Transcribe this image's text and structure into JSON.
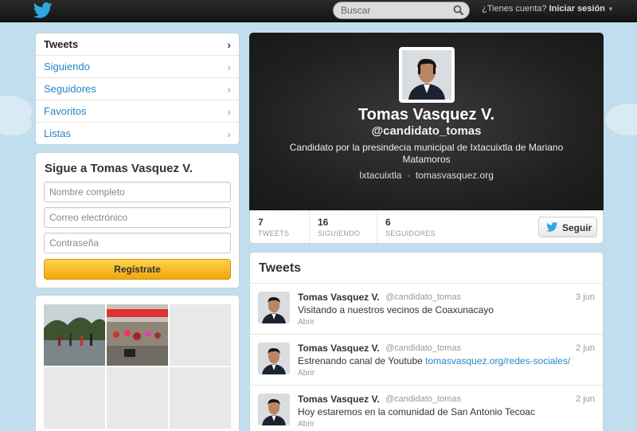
{
  "topbar": {
    "search_placeholder": "Buscar",
    "account_question": "¿Tienes cuenta?",
    "login_label": "Iniciar sesión"
  },
  "nav": {
    "items": [
      {
        "label": "Tweets",
        "active": true
      },
      {
        "label": "Siguiendo"
      },
      {
        "label": "Seguidores"
      },
      {
        "label": "Favoritos"
      },
      {
        "label": "Listas"
      }
    ]
  },
  "signup": {
    "title": "Sigue a Tomas Vasquez V.",
    "name_placeholder": "Nombre completo",
    "email_placeholder": "Correo electrónico",
    "password_placeholder": "Contraseña",
    "submit_label": "Regístrate"
  },
  "profile": {
    "name": "Tomas Vasquez V.",
    "handle": "@candidato_tomas",
    "bio": "Candidato por la presindecia municipal de Ixtacuixtla de Mariano Matamoros",
    "location": "Ixtacuixtla",
    "separator": "·",
    "website": "tomasvasquez.org"
  },
  "stats": [
    {
      "count": "7",
      "label": "TWEETS"
    },
    {
      "count": "16",
      "label": "SIGUIENDO"
    },
    {
      "count": "6",
      "label": "SEGUIDORES"
    }
  ],
  "follow_label": "Seguir",
  "tweets": {
    "title": "Tweets",
    "open_label": "Abrir",
    "items": [
      {
        "name": "Tomas Vasquez V.",
        "handle": "@candidato_tomas",
        "time": "3 jun",
        "text": "Visitando a nuestros vecinos de Coaxunacayo",
        "link": ""
      },
      {
        "name": "Tomas Vasquez V.",
        "handle": "@candidato_tomas",
        "time": "2 jun",
        "text": "Estrenando canal de Youtube ",
        "link": "tomasvasquez.org/redes-sociales/"
      },
      {
        "name": "Tomas Vasquez V.",
        "handle": "@candidato_tomas",
        "time": "2 jun",
        "text": "Hoy estaremos en la comunidad de San Antonio Tecoac",
        "link": ""
      }
    ]
  },
  "colors": {
    "background": "#c0deed",
    "link": "#2a85c5",
    "signup_button": "#f4a50b"
  }
}
